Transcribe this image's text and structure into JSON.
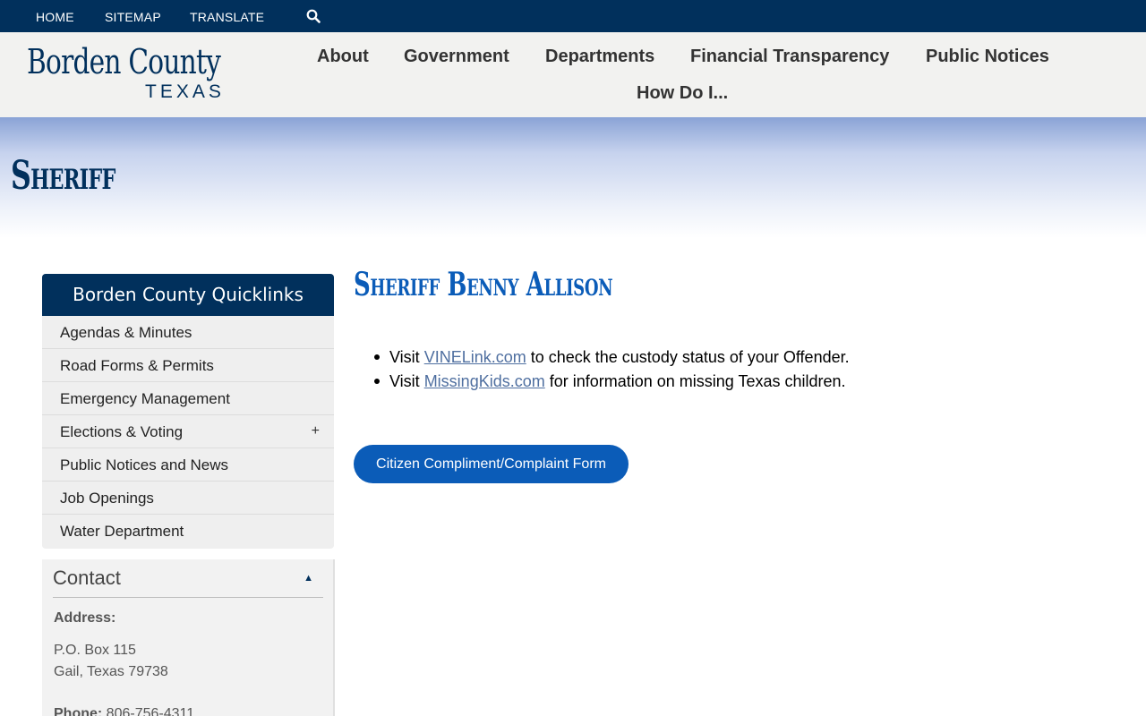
{
  "topbar": {
    "home": "HOME",
    "sitemap": "SITEMAP",
    "translate": "TRANSLATE",
    "search_icon": "search-icon"
  },
  "logo": {
    "main": "Borden County",
    "sub": "TEXAS"
  },
  "nav": {
    "items": [
      "About",
      "Government",
      "Departments",
      "Financial Transparency",
      "Public Notices",
      "How Do I..."
    ]
  },
  "banner": {
    "title": "Sheriff"
  },
  "quicklinks": {
    "title": "Borden County Quicklinks",
    "items": [
      {
        "label": "Agendas & Minutes"
      },
      {
        "label": "Road Forms & Permits"
      },
      {
        "label": "Emergency Management"
      },
      {
        "label": "Elections & Voting",
        "expander": "+"
      },
      {
        "label": "Public Notices and News"
      },
      {
        "label": "Job Openings"
      },
      {
        "label": "Water Department"
      }
    ]
  },
  "contact": {
    "title": "Contact",
    "toggle": "▲",
    "address_label": "Address:",
    "address_line1": "P.O. Box 115",
    "address_line2": "Gail, Texas 79738",
    "phone_label": "Phone:",
    "phone_value": "806-756-4311"
  },
  "main": {
    "heading": "Sheriff Benny Allison",
    "bullets": [
      {
        "prefix": "Visit ",
        "link": "VINELink.com",
        "suffix": " to check the custody status of your Offender."
      },
      {
        "prefix": "Visit ",
        "link": "MissingKids.com",
        "suffix": " for information on missing Texas children."
      }
    ],
    "cta_label": "Citizen Compliment/Complaint Form"
  },
  "colors": {
    "navy": "#01305c",
    "accent_blue": "#0b5cb8",
    "link": "#4f6fa0"
  }
}
